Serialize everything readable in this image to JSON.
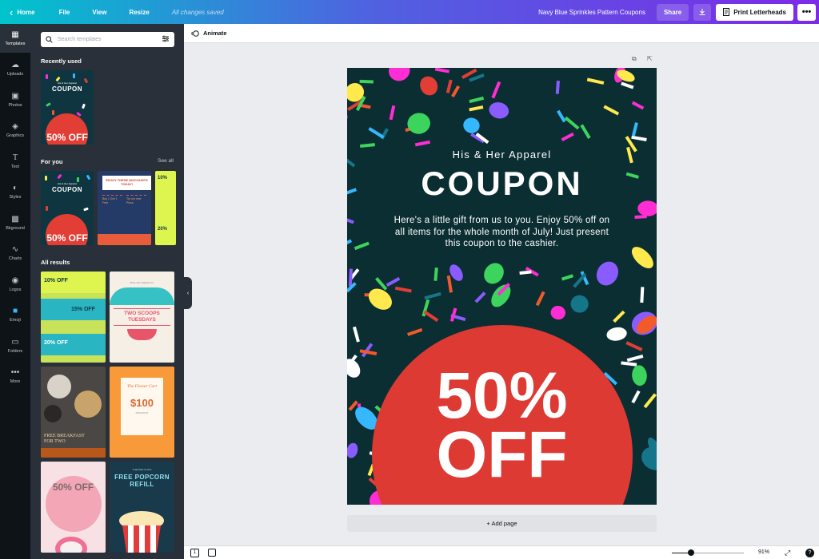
{
  "topbar": {
    "home": "Home",
    "menus": [
      "File",
      "View",
      "Resize"
    ],
    "saved_status": "All changes saved",
    "doc_title": "Navy Blue Sprinkles Pattern Coupons",
    "share": "Share",
    "print": "Print Letterheads"
  },
  "rail": [
    "Templates",
    "Uploads",
    "Photos",
    "Graphics",
    "Text",
    "Styles",
    "Bkground",
    "Charts",
    "Logos",
    "Emoji",
    "Folders",
    "More"
  ],
  "panel": {
    "search_placeholder": "Search templates",
    "recently_used": "Recently used",
    "for_you": "For you",
    "see_all": "See all",
    "all_results": "All results"
  },
  "thumbs": {
    "navy_sub": "His & Her Apparel",
    "navy_title": "COUPON",
    "navy_pct": "50% OFF",
    "menu_head": "ENJOY THESE DISCOUNTS TODAY!",
    "menu_col1": "Buy 1 Get 1 Free",
    "menu_col2": "Try our new Pizza",
    "lime_a": "10%",
    "lime_b": "20%",
    "ten_off_1": "10% OFF",
    "ten_off_2": "15% OFF",
    "ten_off_3": "20% OFF",
    "scoops_head": "RICE OR CREAM CO.",
    "scoops_title": "TWO SCOOPS TUESDAYS",
    "food_title": "FREE BREAKFAST FOR TWO",
    "flower_head": "The Flower Cart",
    "flower_price": "$100",
    "flower_sub": "DISCOUNT",
    "donut_pct": "50% OFF",
    "popcorn_head": "THEATER GUILD",
    "popcorn_title": "FREE POPCORN REFILL"
  },
  "editor": {
    "animate": "Animate",
    "add_page": "+ Add page"
  },
  "coupon": {
    "subtitle": "His & Her Apparel",
    "title": "COUPON",
    "body": "Here's a little gift from us to you. Enjoy 50% off on all items for the whole month of July! Just present this coupon to the cashier.",
    "pct": "50%",
    "off": "OFF",
    "colors": {
      "background": "#0b2e33",
      "badge": "#dd3a33",
      "sprinkles": [
        "#ff2dd4",
        "#8a5cff",
        "#f25a2a",
        "#ffe94d",
        "#3cd45c",
        "#35b8ff",
        "#e23e35",
        "#ffffff",
        "#15768a"
      ]
    }
  },
  "bottombar": {
    "page_count": "1",
    "zoom": "91%",
    "zoom_level": 0.27
  }
}
